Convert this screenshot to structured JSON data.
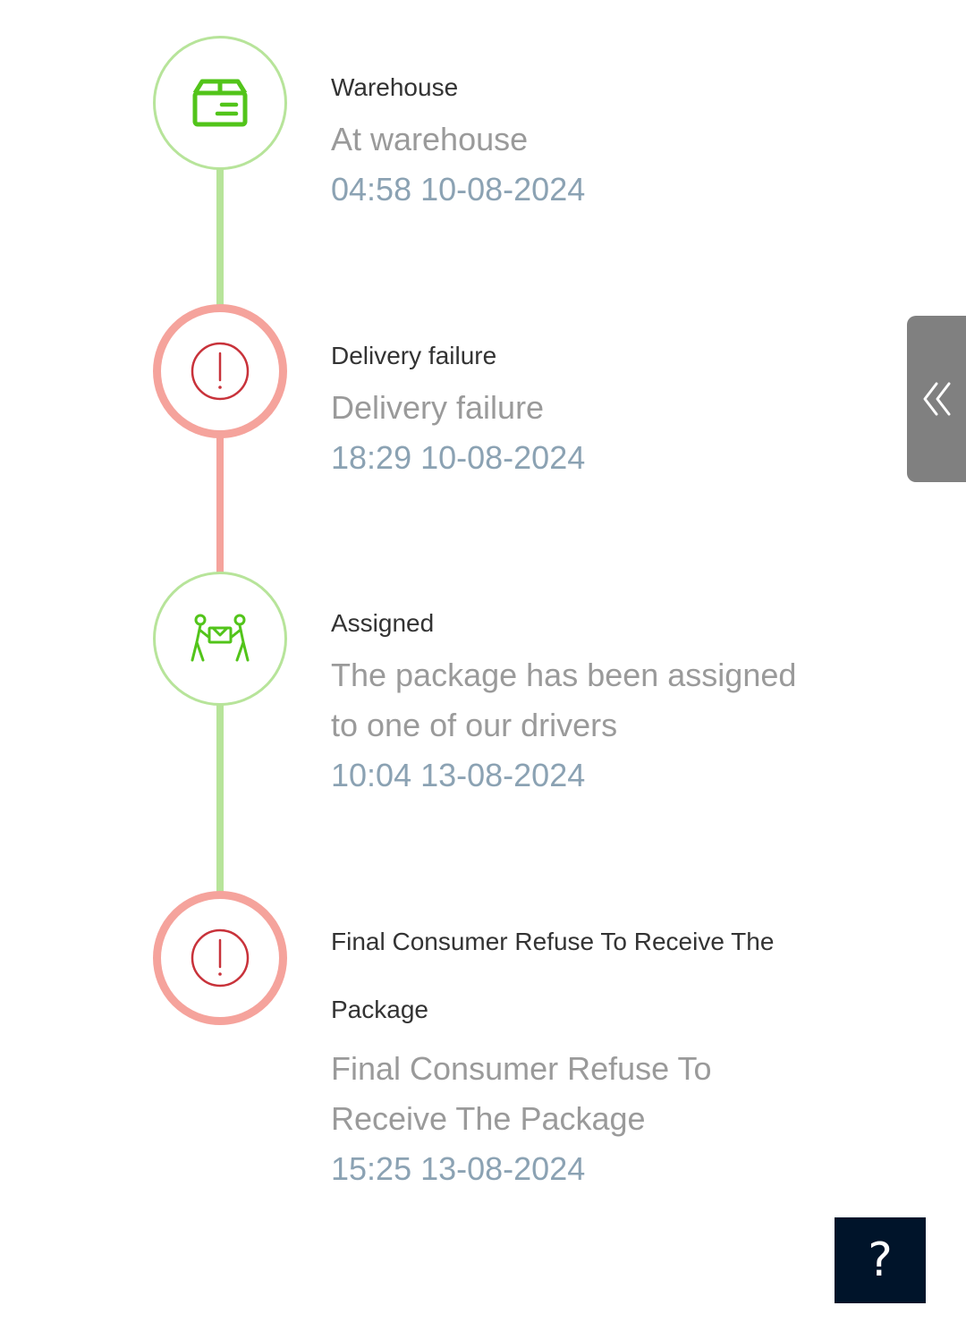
{
  "colors": {
    "success_line": "#b7e49a",
    "success_icon": "#52c41a",
    "failure_ring": "#f5a39c",
    "failure_icon": "#c8323a",
    "title_text": "#333333",
    "desc_text": "#9a9a9a",
    "time_text": "#8ba2b3",
    "side_tab_bg": "#808080",
    "help_bg": "#00142a"
  },
  "timeline": [
    {
      "status": "success",
      "icon": "package-box-icon",
      "title": "Warehouse",
      "description": "At warehouse",
      "time": "04:58 10-08-2024"
    },
    {
      "status": "failure",
      "icon": "exclamation-circle-icon",
      "title": "Delivery failure",
      "description": "Delivery failure",
      "time": "18:29 10-08-2024"
    },
    {
      "status": "success",
      "icon": "people-carrying-box-icon",
      "title": "Assigned",
      "description": "The package has been assigned to one of our drivers",
      "time": "10:04 13-08-2024"
    },
    {
      "status": "failure",
      "icon": "exclamation-circle-icon",
      "title": "Final Consumer Refuse To Receive The Package",
      "description": "Final Consumer Refuse To Receive The Package",
      "time": "15:25 13-08-2024"
    }
  ],
  "side_tab": {
    "icon": "double-chevron-left-icon",
    "glyph": "«"
  },
  "help_button": {
    "icon": "question-mark-icon",
    "glyph": "?"
  }
}
